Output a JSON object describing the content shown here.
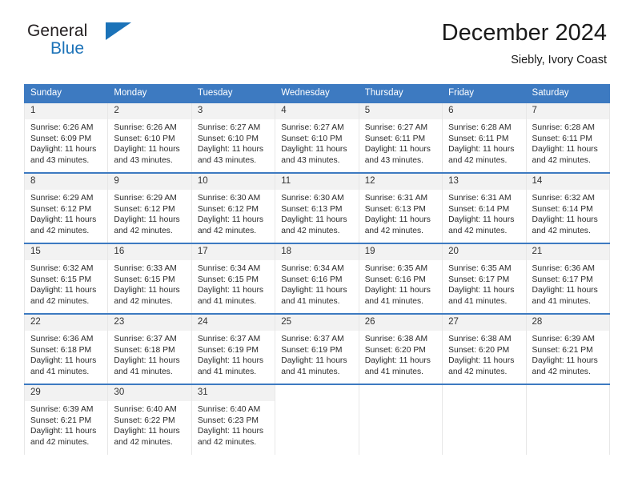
{
  "brand": {
    "name_top": "General",
    "name_bottom": "Blue",
    "accent_color": "#1b72b8"
  },
  "header": {
    "title": "December 2024",
    "subtitle": "Siebly, Ivory Coast"
  },
  "theme": {
    "header_blue": "#3d7ac1",
    "daynum_bg": "#f2f2f2",
    "grid_line": "#e7e7e7"
  },
  "labels": {
    "sunrise_prefix": "Sunrise:",
    "sunset_prefix": "Sunset:",
    "daylight_prefix": "Daylight:"
  },
  "weekdays": [
    "Sunday",
    "Monday",
    "Tuesday",
    "Wednesday",
    "Thursday",
    "Friday",
    "Saturday"
  ],
  "weeks": [
    [
      {
        "day": "1",
        "sunrise": "Sunrise: 6:26 AM",
        "sunset": "Sunset: 6:09 PM",
        "daylight_l1": "Daylight: 11 hours",
        "daylight_l2": "and 43 minutes."
      },
      {
        "day": "2",
        "sunrise": "Sunrise: 6:26 AM",
        "sunset": "Sunset: 6:10 PM",
        "daylight_l1": "Daylight: 11 hours",
        "daylight_l2": "and 43 minutes."
      },
      {
        "day": "3",
        "sunrise": "Sunrise: 6:27 AM",
        "sunset": "Sunset: 6:10 PM",
        "daylight_l1": "Daylight: 11 hours",
        "daylight_l2": "and 43 minutes."
      },
      {
        "day": "4",
        "sunrise": "Sunrise: 6:27 AM",
        "sunset": "Sunset: 6:10 PM",
        "daylight_l1": "Daylight: 11 hours",
        "daylight_l2": "and 43 minutes."
      },
      {
        "day": "5",
        "sunrise": "Sunrise: 6:27 AM",
        "sunset": "Sunset: 6:11 PM",
        "daylight_l1": "Daylight: 11 hours",
        "daylight_l2": "and 43 minutes."
      },
      {
        "day": "6",
        "sunrise": "Sunrise: 6:28 AM",
        "sunset": "Sunset: 6:11 PM",
        "daylight_l1": "Daylight: 11 hours",
        "daylight_l2": "and 42 minutes."
      },
      {
        "day": "7",
        "sunrise": "Sunrise: 6:28 AM",
        "sunset": "Sunset: 6:11 PM",
        "daylight_l1": "Daylight: 11 hours",
        "daylight_l2": "and 42 minutes."
      }
    ],
    [
      {
        "day": "8",
        "sunrise": "Sunrise: 6:29 AM",
        "sunset": "Sunset: 6:12 PM",
        "daylight_l1": "Daylight: 11 hours",
        "daylight_l2": "and 42 minutes."
      },
      {
        "day": "9",
        "sunrise": "Sunrise: 6:29 AM",
        "sunset": "Sunset: 6:12 PM",
        "daylight_l1": "Daylight: 11 hours",
        "daylight_l2": "and 42 minutes."
      },
      {
        "day": "10",
        "sunrise": "Sunrise: 6:30 AM",
        "sunset": "Sunset: 6:12 PM",
        "daylight_l1": "Daylight: 11 hours",
        "daylight_l2": "and 42 minutes."
      },
      {
        "day": "11",
        "sunrise": "Sunrise: 6:30 AM",
        "sunset": "Sunset: 6:13 PM",
        "daylight_l1": "Daylight: 11 hours",
        "daylight_l2": "and 42 minutes."
      },
      {
        "day": "12",
        "sunrise": "Sunrise: 6:31 AM",
        "sunset": "Sunset: 6:13 PM",
        "daylight_l1": "Daylight: 11 hours",
        "daylight_l2": "and 42 minutes."
      },
      {
        "day": "13",
        "sunrise": "Sunrise: 6:31 AM",
        "sunset": "Sunset: 6:14 PM",
        "daylight_l1": "Daylight: 11 hours",
        "daylight_l2": "and 42 minutes."
      },
      {
        "day": "14",
        "sunrise": "Sunrise: 6:32 AM",
        "sunset": "Sunset: 6:14 PM",
        "daylight_l1": "Daylight: 11 hours",
        "daylight_l2": "and 42 minutes."
      }
    ],
    [
      {
        "day": "15",
        "sunrise": "Sunrise: 6:32 AM",
        "sunset": "Sunset: 6:15 PM",
        "daylight_l1": "Daylight: 11 hours",
        "daylight_l2": "and 42 minutes."
      },
      {
        "day": "16",
        "sunrise": "Sunrise: 6:33 AM",
        "sunset": "Sunset: 6:15 PM",
        "daylight_l1": "Daylight: 11 hours",
        "daylight_l2": "and 42 minutes."
      },
      {
        "day": "17",
        "sunrise": "Sunrise: 6:34 AM",
        "sunset": "Sunset: 6:15 PM",
        "daylight_l1": "Daylight: 11 hours",
        "daylight_l2": "and 41 minutes."
      },
      {
        "day": "18",
        "sunrise": "Sunrise: 6:34 AM",
        "sunset": "Sunset: 6:16 PM",
        "daylight_l1": "Daylight: 11 hours",
        "daylight_l2": "and 41 minutes."
      },
      {
        "day": "19",
        "sunrise": "Sunrise: 6:35 AM",
        "sunset": "Sunset: 6:16 PM",
        "daylight_l1": "Daylight: 11 hours",
        "daylight_l2": "and 41 minutes."
      },
      {
        "day": "20",
        "sunrise": "Sunrise: 6:35 AM",
        "sunset": "Sunset: 6:17 PM",
        "daylight_l1": "Daylight: 11 hours",
        "daylight_l2": "and 41 minutes."
      },
      {
        "day": "21",
        "sunrise": "Sunrise: 6:36 AM",
        "sunset": "Sunset: 6:17 PM",
        "daylight_l1": "Daylight: 11 hours",
        "daylight_l2": "and 41 minutes."
      }
    ],
    [
      {
        "day": "22",
        "sunrise": "Sunrise: 6:36 AM",
        "sunset": "Sunset: 6:18 PM",
        "daylight_l1": "Daylight: 11 hours",
        "daylight_l2": "and 41 minutes."
      },
      {
        "day": "23",
        "sunrise": "Sunrise: 6:37 AM",
        "sunset": "Sunset: 6:18 PM",
        "daylight_l1": "Daylight: 11 hours",
        "daylight_l2": "and 41 minutes."
      },
      {
        "day": "24",
        "sunrise": "Sunrise: 6:37 AM",
        "sunset": "Sunset: 6:19 PM",
        "daylight_l1": "Daylight: 11 hours",
        "daylight_l2": "and 41 minutes."
      },
      {
        "day": "25",
        "sunrise": "Sunrise: 6:37 AM",
        "sunset": "Sunset: 6:19 PM",
        "daylight_l1": "Daylight: 11 hours",
        "daylight_l2": "and 41 minutes."
      },
      {
        "day": "26",
        "sunrise": "Sunrise: 6:38 AM",
        "sunset": "Sunset: 6:20 PM",
        "daylight_l1": "Daylight: 11 hours",
        "daylight_l2": "and 41 minutes."
      },
      {
        "day": "27",
        "sunrise": "Sunrise: 6:38 AM",
        "sunset": "Sunset: 6:20 PM",
        "daylight_l1": "Daylight: 11 hours",
        "daylight_l2": "and 42 minutes."
      },
      {
        "day": "28",
        "sunrise": "Sunrise: 6:39 AM",
        "sunset": "Sunset: 6:21 PM",
        "daylight_l1": "Daylight: 11 hours",
        "daylight_l2": "and 42 minutes."
      }
    ],
    [
      {
        "day": "29",
        "sunrise": "Sunrise: 6:39 AM",
        "sunset": "Sunset: 6:21 PM",
        "daylight_l1": "Daylight: 11 hours",
        "daylight_l2": "and 42 minutes."
      },
      {
        "day": "30",
        "sunrise": "Sunrise: 6:40 AM",
        "sunset": "Sunset: 6:22 PM",
        "daylight_l1": "Daylight: 11 hours",
        "daylight_l2": "and 42 minutes."
      },
      {
        "day": "31",
        "sunrise": "Sunrise: 6:40 AM",
        "sunset": "Sunset: 6:23 PM",
        "daylight_l1": "Daylight: 11 hours",
        "daylight_l2": "and 42 minutes."
      },
      {
        "day": "",
        "sunrise": "",
        "sunset": "",
        "daylight_l1": "",
        "daylight_l2": ""
      },
      {
        "day": "",
        "sunrise": "",
        "sunset": "",
        "daylight_l1": "",
        "daylight_l2": ""
      },
      {
        "day": "",
        "sunrise": "",
        "sunset": "",
        "daylight_l1": "",
        "daylight_l2": ""
      },
      {
        "day": "",
        "sunrise": "",
        "sunset": "",
        "daylight_l1": "",
        "daylight_l2": ""
      }
    ]
  ]
}
